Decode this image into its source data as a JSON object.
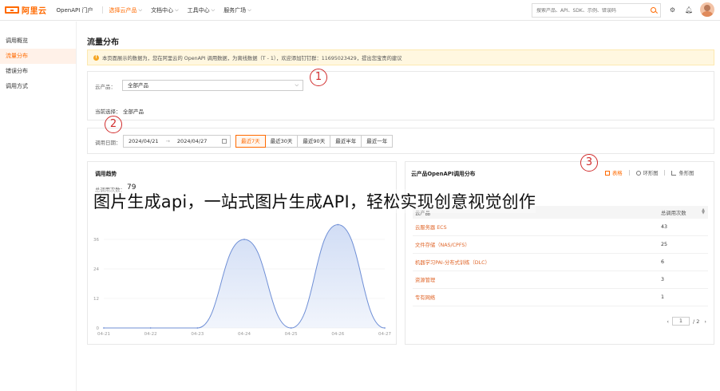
{
  "header": {
    "logo_text": "阿里云",
    "nav": [
      {
        "label": "OpenAPI 门户"
      },
      {
        "label": "选择云产品",
        "active": true
      },
      {
        "label": "文档中心"
      },
      {
        "label": "工具中心"
      },
      {
        "label": "服务广场"
      }
    ],
    "search_placeholder": "搜索产品、API、SDK、示例、错误码"
  },
  "sidebar": {
    "items": [
      {
        "label": "调用概览"
      },
      {
        "label": "流量分布",
        "active": true
      },
      {
        "label": "错误分布"
      },
      {
        "label": "调用方式"
      }
    ]
  },
  "page_title": "流量分布",
  "notice": "本页面展示的数据为，您在阿里云的 OpenAPI 调用数据，为离线数据（T - 1），欢迎添加钉钉群：11695023429，提出您宝贵的建议",
  "filter": {
    "label": "云产品：",
    "selected": "全部产品",
    "current_label": "当前选择：",
    "current_value": "全部产品"
  },
  "date_filter": {
    "label": "调用日期：",
    "start": "2024/04/21",
    "separator": "→",
    "end": "2024/04/27",
    "buttons": [
      {
        "label": "最近7天",
        "active": true
      },
      {
        "label": "最近30天"
      },
      {
        "label": "最近90天"
      },
      {
        "label": "最近半年"
      },
      {
        "label": "最近一年"
      }
    ]
  },
  "trend": {
    "title": "调用趋势",
    "total_label": "总调用次数：",
    "total_value": "79"
  },
  "chart_data": {
    "type": "area",
    "title": "调用趋势",
    "x": [
      "04-21",
      "04-22",
      "04-23",
      "04-24",
      "04-25",
      "04-26",
      "04-27"
    ],
    "values": [
      0,
      0,
      0,
      36,
      0,
      42,
      0
    ],
    "yticks": [
      0,
      12,
      24,
      36
    ],
    "ylim": [
      0,
      48
    ],
    "grid": true,
    "smooth": true,
    "colors": {
      "line": "#6f8fd6",
      "fill": "#c9d7f3"
    }
  },
  "distribution": {
    "title": "云产品OpenAPI调用分布",
    "views": [
      {
        "label": "表格",
        "active": true
      },
      {
        "label": "环形图"
      },
      {
        "label": "条形图"
      }
    ],
    "columns": [
      "云产品",
      "总调用次数"
    ],
    "rows": [
      {
        "product": "云服务器 ECS",
        "count": "43"
      },
      {
        "product": "文件存储（NAS/CPFS）",
        "count": "25"
      },
      {
        "product": "机器学习PAI-分布式训练（DLC）",
        "count": "6"
      },
      {
        "product": "资源管理",
        "count": "3"
      },
      {
        "product": "专有网络",
        "count": "1"
      }
    ],
    "pager": {
      "current": "1",
      "total": "/ 2"
    }
  },
  "markers": [
    "1",
    "2",
    "3"
  ],
  "overlay_text": "图片生成api，一站式图片生成API，轻松实现创意视觉创作",
  "colors": {
    "accent": "#ff6a00",
    "marker": "#d12c2c"
  }
}
